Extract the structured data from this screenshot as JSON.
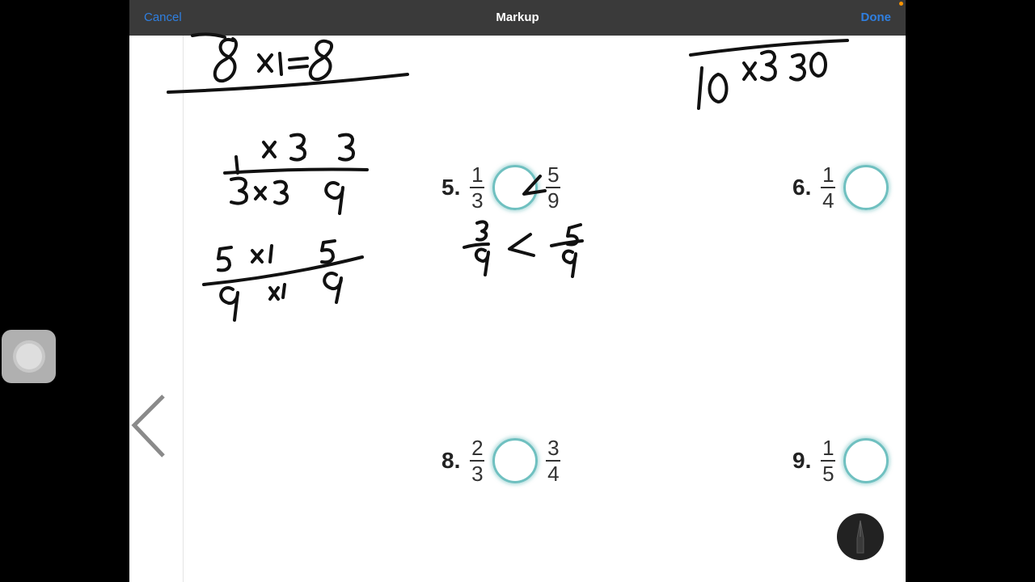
{
  "toolbar": {
    "cancel_label": "Cancel",
    "title": "Markup",
    "done_label": "Done",
    "accent_color": "#2f7fe0"
  },
  "problems": [
    {
      "number": "5.",
      "left": {
        "num": "1",
        "den": "3"
      },
      "right": {
        "num": "5",
        "den": "9"
      },
      "answer": "<"
    },
    {
      "number": "6.",
      "left": {
        "num": "1",
        "den": "4"
      },
      "answer": ""
    },
    {
      "number": "8.",
      "left": {
        "num": "2",
        "den": "3"
      },
      "right": {
        "num": "3",
        "den": "4"
      },
      "answer": ""
    },
    {
      "number": "9.",
      "left": {
        "num": "1",
        "den": "5"
      },
      "answer": ""
    }
  ],
  "icons": [
    "assistive-touch-icon",
    "back-chevron-icon",
    "pen-icon"
  ]
}
